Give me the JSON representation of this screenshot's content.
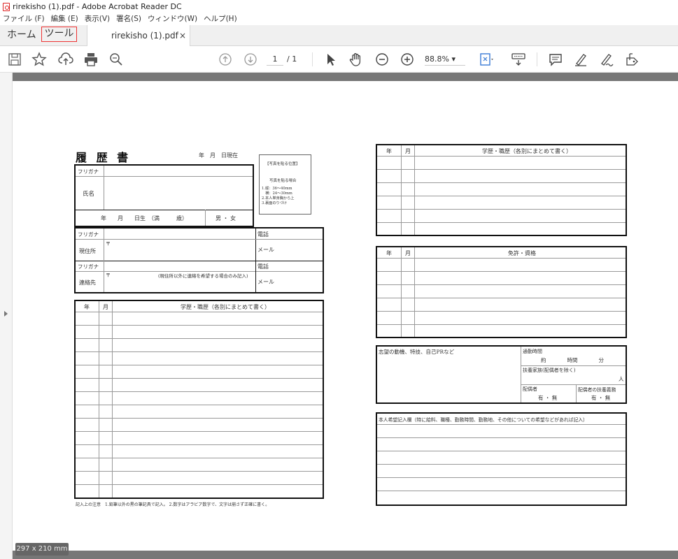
{
  "window": {
    "title": "rirekisho (1).pdf - Adobe Acrobat Reader DC"
  },
  "menu": [
    "ファイル (F)",
    "編集 (E)",
    "表示(V)",
    "署名(S)",
    "ウィンドウ(W)",
    "ヘルプ(H)"
  ],
  "tabs": {
    "home": "ホーム",
    "tools": "ツール",
    "doc": "rirekisho (1).pdf",
    "close": "×"
  },
  "toolbar": {
    "page_current": "1",
    "page_total": "/ 1",
    "zoom": "88.8%  ▾"
  },
  "status": {
    "page_size": "297 x 210 mm"
  },
  "resume": {
    "title": "履 歴 書",
    "date_now": "年　月　日現在",
    "photo": {
      "head": "【写真を貼る位置】",
      "sub": "写真を貼る場合",
      "l1": "1.縦：36〜40mm",
      "l2": "　横：24〜30mm",
      "l3": "2.本人単身胸から上",
      "l4": "3.裏面のりづけ"
    },
    "furigana": "フリガナ",
    "name": "氏名",
    "birth": "年　　月　　日生　（満　　　歳）",
    "sex": "男 ・ 女",
    "address": "現住所",
    "postal": "〒",
    "phone": "電話",
    "mail": "メール",
    "contact": "連絡先",
    "contact_note": "(現住所以外に連絡を希望する場合のみ記入)",
    "col_year": "年",
    "col_month": "月",
    "history_header": "学歴・職歴（各別にまとめて書く）",
    "license_header": "免許・資格",
    "motive": "志望の動機、特技、自己PRなど",
    "commute": "通勤時間",
    "commute_val": "約　　　　時間　　　　分",
    "dependents": "扶養家族(配偶者を除く)",
    "dependents_unit": "人",
    "spouse": "配偶者",
    "spouse_support": "配偶者の扶養義務",
    "yes_no": "有 ・ 無",
    "wish": "本人希望記入欄（特に給料、職種、勤務時間、勤務地、その他についての希望などがあれば記入）",
    "note": "記入上の注意　1.鉛筆以外の黒の筆記具で記入。 2.数字はアラビア数字で、文字は崩さず正確に書く。"
  }
}
